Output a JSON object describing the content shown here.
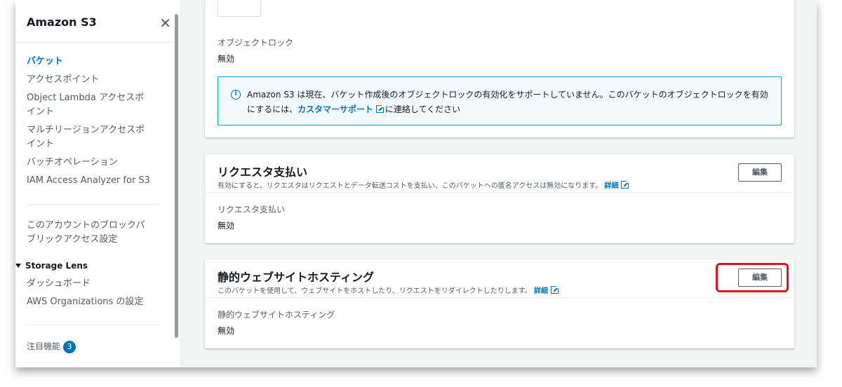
{
  "sidebar": {
    "title": "Amazon S3",
    "close_glyph": "✕",
    "items": [
      {
        "label": "バケット",
        "active": true
      },
      {
        "label": "アクセスポイント"
      },
      {
        "label": "Object Lambda アクセスポイント"
      },
      {
        "label": "マルチリージョンアクセスポイント"
      },
      {
        "label": "バッチオペレーション"
      },
      {
        "label": "IAM Access Analyzer for S3"
      }
    ],
    "block_access": "このアカウントのブロックパブリックアクセス設定",
    "storage_lens": {
      "label": "Storage Lens",
      "items": [
        {
          "label": "ダッシュボード"
        },
        {
          "label": "AWS Organizations の設定"
        }
      ]
    },
    "featured": {
      "label": "注目機能",
      "count": "3"
    }
  },
  "object_lock": {
    "field_label": "オブジェクトロック",
    "value": "無効",
    "info": {
      "text_before": "Amazon S3 は現在、バケット作成後のオブジェクトロックの有効化をサポートしていません。このバケットのオブジェクトロックを有効にするには、",
      "link": "カスタマーサポート",
      "text_after": "に連絡してください"
    }
  },
  "requester_pays": {
    "title": "リクエスタ支払い",
    "description": "有効にすると、リクエスタはリクエストとデータ転送コストを支払い、このバケットへの匿名アクセスは無効になります。",
    "detail_link": "詳細",
    "edit_label": "編集",
    "field_label": "リクエスタ支払い",
    "value": "無効"
  },
  "static_hosting": {
    "title": "静的ウェブサイトホスティング",
    "description": "このバケットを使用して、ウェブサイトをホストしたり、リクエストをリダイレクトしたりします。",
    "detail_link": "詳細",
    "edit_label": "編集",
    "field_label": "静的ウェブサイトホスティング",
    "value": "無効"
  },
  "colors": {
    "link": "#0073bb",
    "highlight": "#e8101e",
    "info_border": "#00a1c9"
  }
}
